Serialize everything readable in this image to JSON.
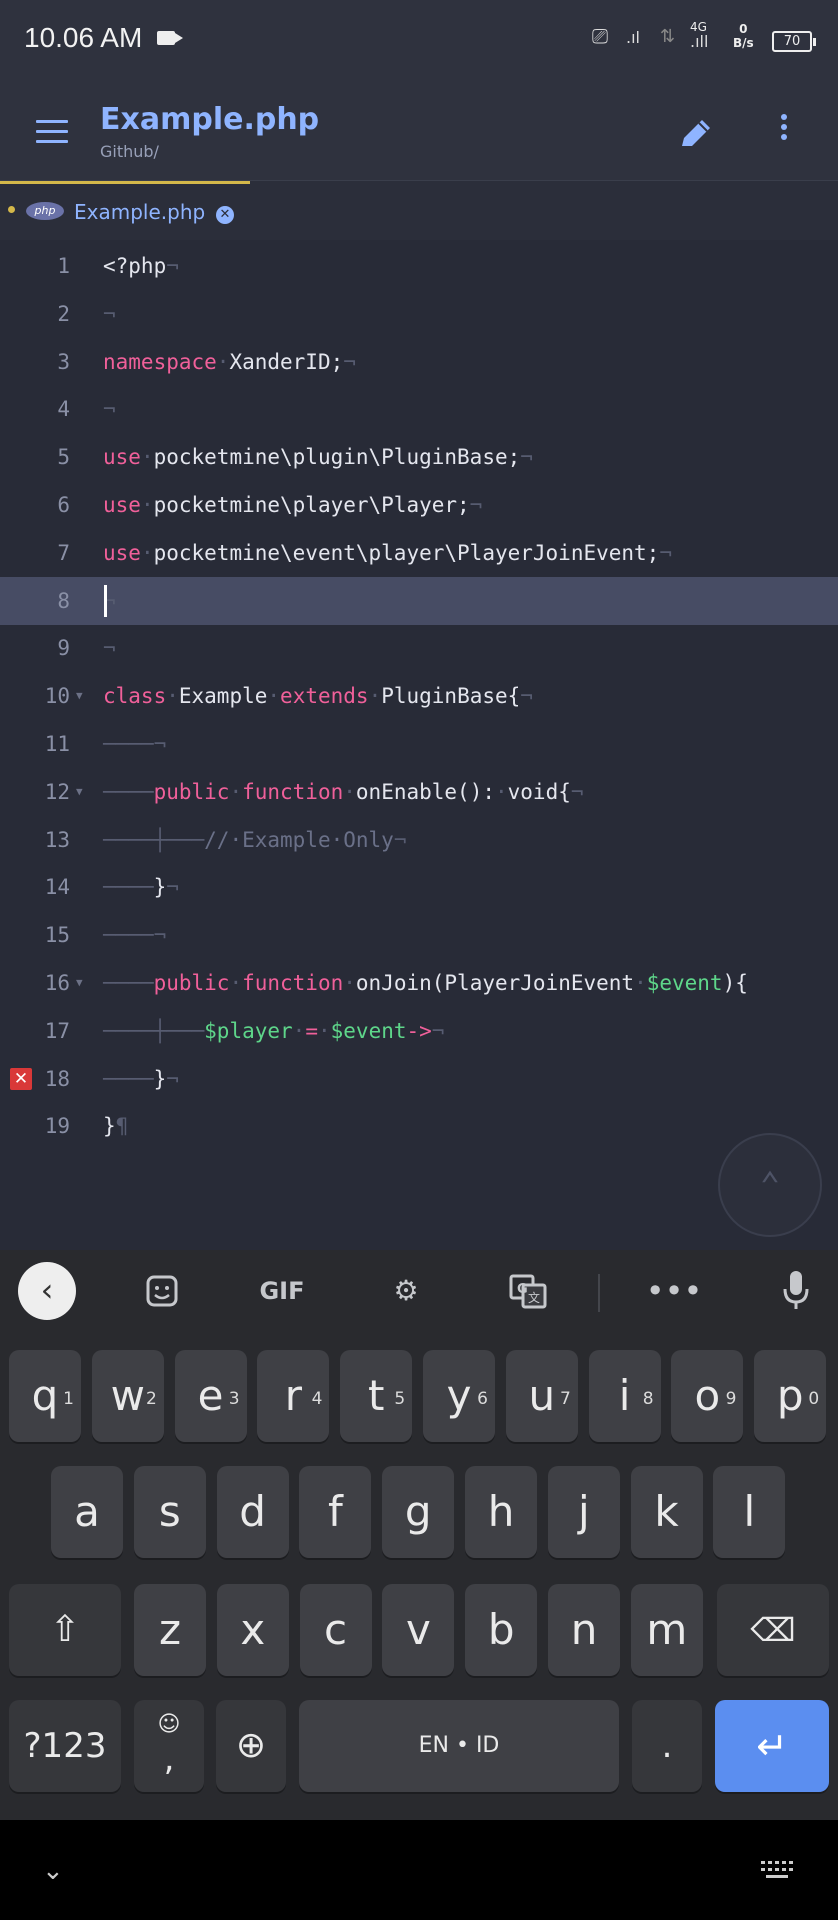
{
  "status_bar": {
    "time": "10.06 AM",
    "network": "4G",
    "speed_value": "0",
    "speed_unit": "B/s",
    "battery": "70"
  },
  "app_bar": {
    "title": "Example.php",
    "subtitle": "Github/",
    "icons": [
      "menu-icon",
      "pencil-icon",
      "more-vert-icon"
    ],
    "accent_color": "#8fb4ff"
  },
  "tabs": [
    {
      "badge": "php",
      "label": "Example.php",
      "modified": true,
      "close_icon": "close-circle-icon"
    }
  ],
  "editor": {
    "active_line": 8,
    "error_line": 18,
    "lines": [
      {
        "n": "1",
        "indent": "",
        "tokens": [
          {
            "t": "<?php",
            "c": "id"
          },
          {
            "t": "¬",
            "c": "ws"
          }
        ]
      },
      {
        "n": "2",
        "indent": "",
        "tokens": [
          {
            "t": "¬",
            "c": "ws"
          }
        ]
      },
      {
        "n": "3",
        "indent": "",
        "tokens": [
          {
            "t": "namespace",
            "c": "kw"
          },
          {
            "t": "·",
            "c": "ws"
          },
          {
            "t": "XanderID;",
            "c": "id"
          },
          {
            "t": "¬",
            "c": "ws"
          }
        ]
      },
      {
        "n": "4",
        "indent": "",
        "tokens": [
          {
            "t": "¬",
            "c": "ws"
          }
        ]
      },
      {
        "n": "5",
        "indent": "",
        "tokens": [
          {
            "t": "use",
            "c": "kw"
          },
          {
            "t": "·",
            "c": "ws"
          },
          {
            "t": "pocketmine\\plugin\\PluginBase;",
            "c": "id"
          },
          {
            "t": "¬",
            "c": "ws"
          }
        ]
      },
      {
        "n": "6",
        "indent": "",
        "tokens": [
          {
            "t": "use",
            "c": "kw"
          },
          {
            "t": "·",
            "c": "ws"
          },
          {
            "t": "pocketmine\\player\\Player;",
            "c": "id"
          },
          {
            "t": "¬",
            "c": "ws"
          }
        ]
      },
      {
        "n": "7",
        "indent": "",
        "tokens": [
          {
            "t": "use",
            "c": "kw"
          },
          {
            "t": "·",
            "c": "ws"
          },
          {
            "t": "pocketmine\\event\\player\\PlayerJoinEvent;",
            "c": "id"
          },
          {
            "t": "¬",
            "c": "ws"
          }
        ]
      },
      {
        "n": "8",
        "indent": "",
        "tokens": [
          {
            "t": "¬",
            "c": "ws"
          }
        ]
      },
      {
        "n": "9",
        "indent": "",
        "tokens": [
          {
            "t": "¬",
            "c": "ws"
          }
        ]
      },
      {
        "n": "10",
        "fold": true,
        "indent": "",
        "tokens": [
          {
            "t": "class",
            "c": "kw"
          },
          {
            "t": "·",
            "c": "ws"
          },
          {
            "t": "Example",
            "c": "id"
          },
          {
            "t": "·",
            "c": "ws"
          },
          {
            "t": "extends",
            "c": "kw"
          },
          {
            "t": "·",
            "c": "ws"
          },
          {
            "t": "PluginBase{",
            "c": "id"
          },
          {
            "t": "¬",
            "c": "ws"
          }
        ]
      },
      {
        "n": "11",
        "indent": "────",
        "tokens": [
          {
            "t": "¬",
            "c": "ws"
          }
        ]
      },
      {
        "n": "12",
        "fold": true,
        "indent": "────",
        "tokens": [
          {
            "t": "public",
            "c": "kw"
          },
          {
            "t": "·",
            "c": "ws"
          },
          {
            "t": "function",
            "c": "kw"
          },
          {
            "t": "·",
            "c": "ws"
          },
          {
            "t": "onEnable():",
            "c": "id"
          },
          {
            "t": "·",
            "c": "ws"
          },
          {
            "t": "void{",
            "c": "id"
          },
          {
            "t": "¬",
            "c": "ws"
          }
        ]
      },
      {
        "n": "13",
        "indent": "────┼───",
        "tokens": [
          {
            "t": "//·Example·Only",
            "c": "cm"
          },
          {
            "t": "¬",
            "c": "ws"
          }
        ]
      },
      {
        "n": "14",
        "indent": "────",
        "tokens": [
          {
            "t": "}",
            "c": "id"
          },
          {
            "t": "¬",
            "c": "ws"
          }
        ]
      },
      {
        "n": "15",
        "indent": "────",
        "tokens": [
          {
            "t": "¬",
            "c": "ws"
          }
        ]
      },
      {
        "n": "16",
        "fold": true,
        "indent": "────",
        "tokens": [
          {
            "t": "public",
            "c": "kw"
          },
          {
            "t": "·",
            "c": "ws"
          },
          {
            "t": "function",
            "c": "kw"
          },
          {
            "t": "·",
            "c": "ws"
          },
          {
            "t": "onJoin(PlayerJoinEvent",
            "c": "id"
          },
          {
            "t": "·",
            "c": "ws"
          },
          {
            "t": "$event",
            "c": "var"
          },
          {
            "t": "){",
            "c": "id"
          }
        ]
      },
      {
        "n": "17",
        "indent": "────┼───",
        "tokens": [
          {
            "t": "$player",
            "c": "var"
          },
          {
            "t": "·",
            "c": "ws"
          },
          {
            "t": "=",
            "c": "kw"
          },
          {
            "t": "·",
            "c": "ws"
          },
          {
            "t": "$event",
            "c": "var"
          },
          {
            "t": "->",
            "c": "kw"
          },
          {
            "t": "¬",
            "c": "ws"
          }
        ]
      },
      {
        "n": "18",
        "indent": "────",
        "tokens": [
          {
            "t": "}",
            "c": "id"
          },
          {
            "t": "¬",
            "c": "ws"
          }
        ]
      },
      {
        "n": "19",
        "indent": "",
        "tokens": [
          {
            "t": "}",
            "c": "id"
          },
          {
            "t": "¶",
            "c": "ws"
          }
        ]
      }
    ],
    "colors": {
      "keyword": "#f0609a",
      "identifier": "#e4e6ee",
      "variable": "#5ed68a",
      "comment": "#6a7088",
      "whitespace": "#575c71"
    }
  },
  "keyboard": {
    "toolbar": {
      "gif_label": "GIF",
      "icons": [
        "back-arrow-icon",
        "sticker-icon",
        "gif-icon",
        "settings-icon",
        "translate-icon",
        "more-horiz-icon",
        "mic-icon"
      ]
    },
    "row1": [
      {
        "k": "q",
        "h": "1"
      },
      {
        "k": "w",
        "h": "2"
      },
      {
        "k": "e",
        "h": "3"
      },
      {
        "k": "r",
        "h": "4"
      },
      {
        "k": "t",
        "h": "5"
      },
      {
        "k": "y",
        "h": "6"
      },
      {
        "k": "u",
        "h": "7"
      },
      {
        "k": "i",
        "h": "8"
      },
      {
        "k": "o",
        "h": "9"
      },
      {
        "k": "p",
        "h": "0"
      }
    ],
    "row2": [
      "a",
      "s",
      "d",
      "f",
      "g",
      "h",
      "j",
      "k",
      "l"
    ],
    "row3": [
      "z",
      "x",
      "c",
      "v",
      "b",
      "n",
      "m"
    ],
    "symbols_label": "?123",
    "comma_label": ",",
    "emoji_hint": "☺",
    "space_label": "EN • ID",
    "period_label": ".",
    "accent_color": "#5b8ef0"
  }
}
